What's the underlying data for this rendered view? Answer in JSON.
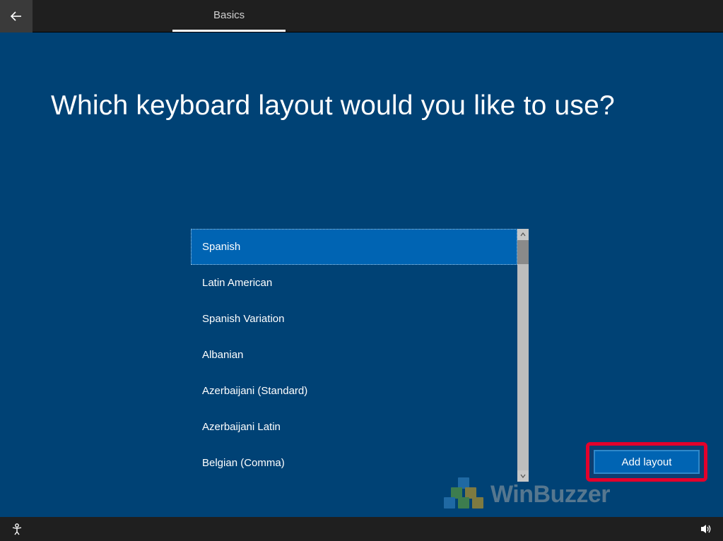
{
  "header": {
    "tab_label": "Basics"
  },
  "main": {
    "heading": "Which keyboard layout would you like to use?",
    "add_button_label": "Add layout"
  },
  "layouts": {
    "selected_index": 0,
    "items": [
      "Spanish",
      "Latin American",
      "Spanish Variation",
      "Albanian",
      "Azerbaijani (Standard)",
      "Azerbaijani Latin",
      "Belgian (Comma)"
    ]
  },
  "watermark": {
    "text": "WinBuzzer"
  },
  "icons": {
    "back": "back-arrow",
    "accessibility": "ease-of-access",
    "volume": "speaker"
  }
}
